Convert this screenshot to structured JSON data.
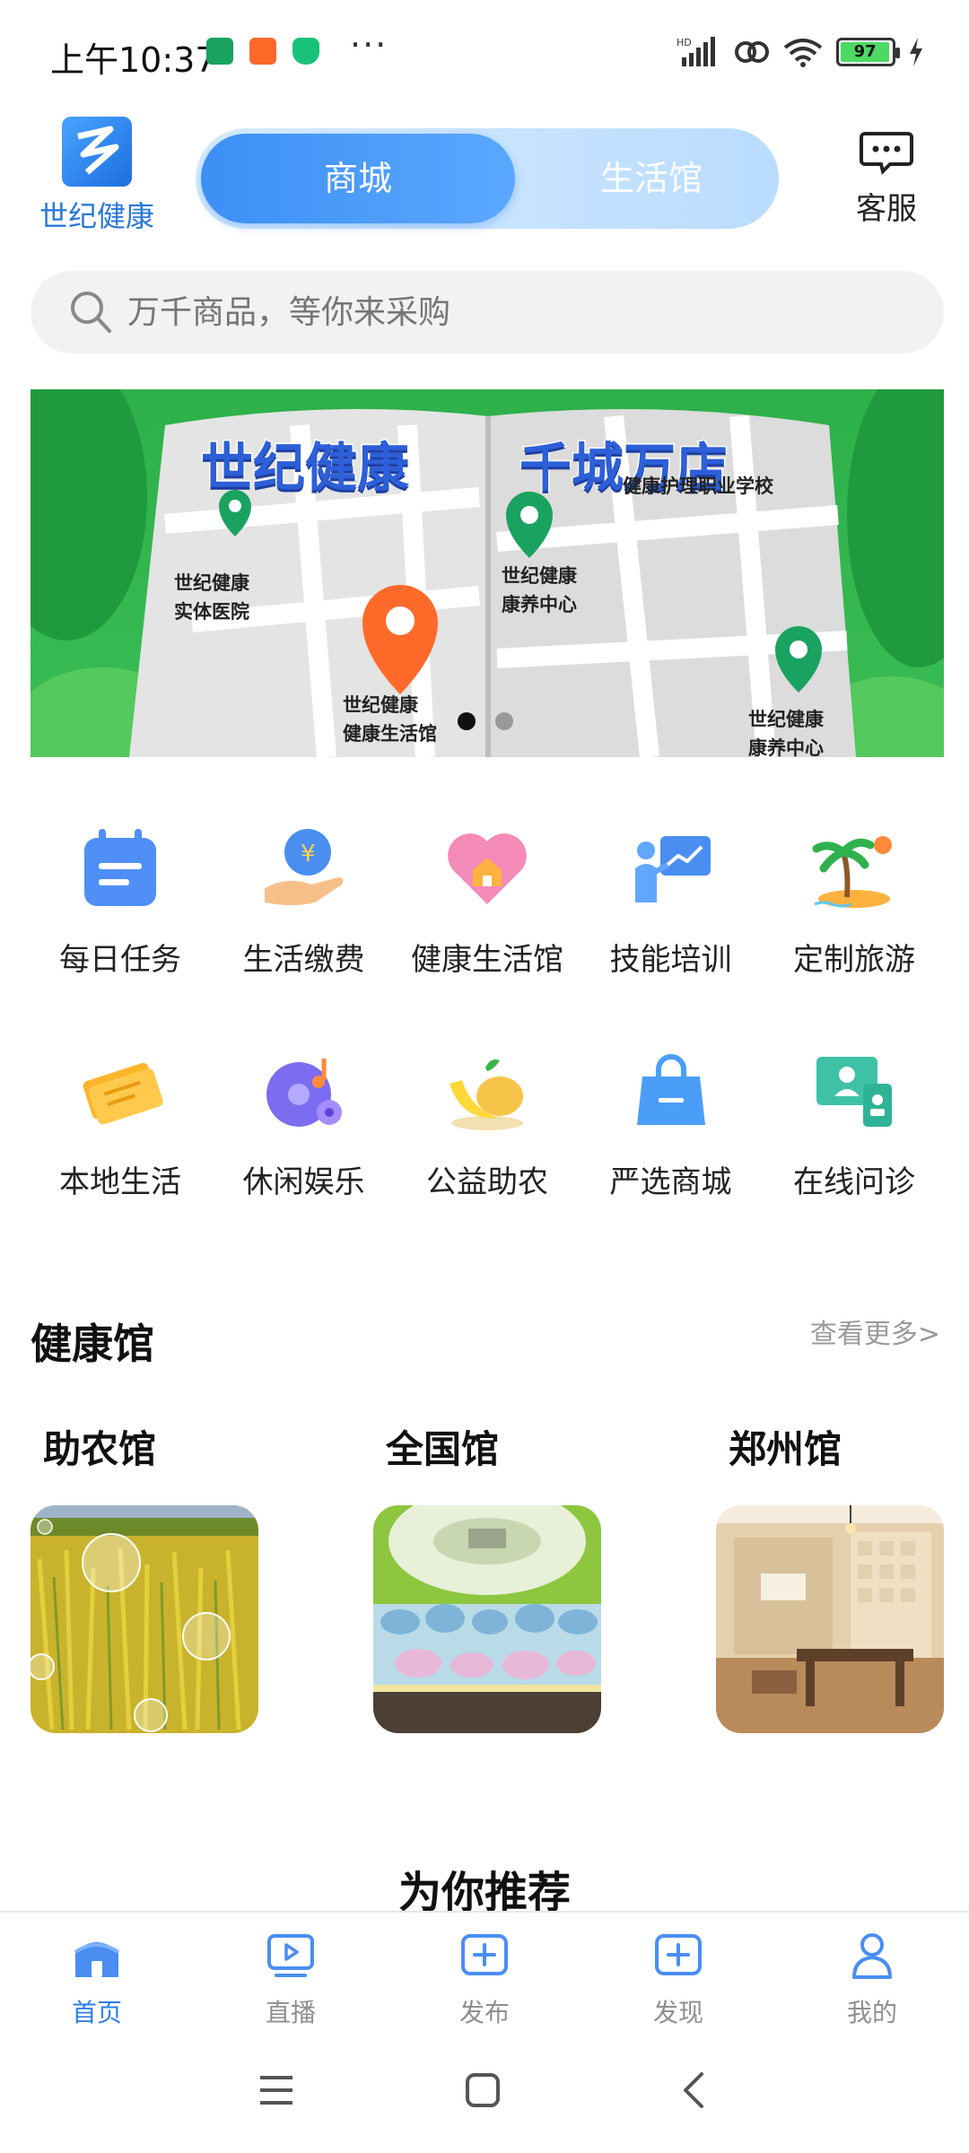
{
  "status_bar": {
    "time": "上午10:37",
    "more": "···",
    "battery": "97",
    "signal_label": "HD"
  },
  "header": {
    "logo_text": "世纪健康",
    "tabs": [
      {
        "label": "商城",
        "active": true
      },
      {
        "label": "生活馆",
        "active": false
      }
    ],
    "service_label": "客服"
  },
  "search": {
    "placeholder": "万千商品，等你来采购"
  },
  "banner": {
    "title_left": "世纪健康",
    "title_right": "千城万店",
    "labels": {
      "hospital": "世纪健康\n实体医院",
      "center_top": "世纪健康\n康养中心",
      "life_hall": "世纪健康\n健康生活馆",
      "center_bottom": "世纪健康\n康养中心",
      "school": "健康护理职业学校"
    },
    "active_slide": 1,
    "slide_count": 2
  },
  "grid": {
    "row1": [
      {
        "label": "每日任务",
        "icon": "calendar-icon"
      },
      {
        "label": "生活缴费",
        "icon": "payment-hand-icon"
      },
      {
        "label": "健康生活馆",
        "icon": "heart-house-icon"
      },
      {
        "label": "技能培训",
        "icon": "training-icon"
      },
      {
        "label": "定制旅游",
        "icon": "palm-island-icon"
      }
    ],
    "row2": [
      {
        "label": "本地生活",
        "icon": "ticket-icon"
      },
      {
        "label": "休闲娱乐",
        "icon": "music-disc-icon"
      },
      {
        "label": "公益助农",
        "icon": "fruit-icon"
      },
      {
        "label": "严选商城",
        "icon": "shopping-bag-icon"
      },
      {
        "label": "在线问诊",
        "icon": "online-doctor-icon"
      }
    ]
  },
  "health": {
    "title": "健康馆",
    "more": "查看更多>",
    "halls": [
      {
        "name": "助农馆",
        "image": "rice-field-image"
      },
      {
        "name": "全国馆",
        "image": "exhibition-hall-image"
      },
      {
        "name": "郑州馆",
        "image": "tea-room-image"
      }
    ]
  },
  "recommend": {
    "title": "为你推荐"
  },
  "bottom_nav": [
    {
      "label": "首页",
      "icon": "home-icon",
      "active": true
    },
    {
      "label": "直播",
      "icon": "live-play-icon",
      "active": false
    },
    {
      "label": "发布",
      "icon": "publish-plus-icon",
      "active": false
    },
    {
      "label": "发现",
      "icon": "discover-plus-icon",
      "active": false
    },
    {
      "label": "我的",
      "icon": "profile-icon",
      "active": false
    }
  ],
  "colors": {
    "accent": "#2f7fe8",
    "tab_active": "#3d8ff5",
    "banner_green": "#2db04a",
    "pin_orange": "#ff6a2a",
    "pin_green": "#1aa260"
  }
}
